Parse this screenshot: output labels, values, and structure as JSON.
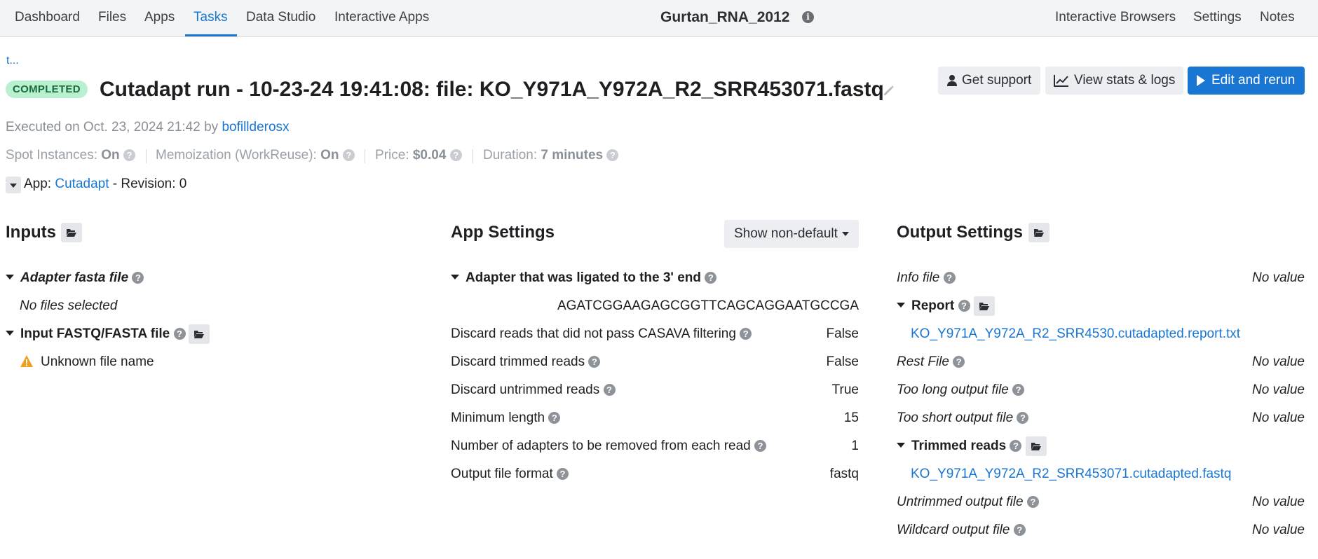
{
  "nav": {
    "left": [
      "Dashboard",
      "Files",
      "Apps",
      "Tasks",
      "Data Studio",
      "Interactive Apps"
    ],
    "active": "Tasks",
    "project": "Gurtan_RNA_2012",
    "right": [
      "Interactive Browsers",
      "Settings",
      "Notes"
    ]
  },
  "header": {
    "back": "t...",
    "status": "COMPLETED",
    "title": "Cutadapt run - 10-23-24 19:41:08: file: KO_Y971A_Y972A_R2_SRR453071.fastq",
    "buttons": {
      "support": "Get support",
      "stats": "View stats & logs",
      "rerun": "Edit and rerun"
    },
    "executed_prefix": "Executed on Oct. 23, 2024 21:42 by",
    "executed_user": "bofillderosx",
    "meta": {
      "spot_label": "Spot Instances:",
      "spot_value": "On",
      "memo_label": "Memoization (WorkReuse):",
      "memo_value": "On",
      "price_label": "Price:",
      "price_value": "$0.04",
      "duration_label": "Duration:",
      "duration_value": "7 minutes"
    },
    "app_label": "App:",
    "app_name": "Cutadapt",
    "revision": "- Revision: 0"
  },
  "inputs": {
    "title": "Inputs",
    "adapter_label": "Adapter fasta file",
    "adapter_value": "No files selected",
    "fastq_label": "Input FASTQ/FASTA file",
    "fastq_value": "Unknown file name"
  },
  "app_settings": {
    "title": "App Settings",
    "filter": "Show non-default",
    "adapter_label": "Adapter that was ligated to the 3' end",
    "adapter_value": "AGATCGGAAGAGCGGTTCAGCAGGAATGCCGA",
    "rows": [
      {
        "label": "Discard reads that did not pass CASAVA filtering",
        "value": "False"
      },
      {
        "label": "Discard trimmed reads",
        "value": "False"
      },
      {
        "label": "Discard untrimmed reads",
        "value": "True"
      },
      {
        "label": "Minimum length",
        "value": "15"
      },
      {
        "label": "Number of adapters to be removed from each read",
        "value": "1"
      },
      {
        "label": "Output file format",
        "value": "fastq"
      }
    ]
  },
  "output_settings": {
    "title": "Output Settings",
    "no_value": "No value",
    "info_label": "Info file",
    "report_label": "Report",
    "report_file": "KO_Y971A_Y972A_R2_SRR4530.cutadapted.report.txt",
    "rest_label": "Rest File",
    "too_long_label": "Too long output file",
    "too_short_label": "Too short output file",
    "trimmed_label": "Trimmed reads",
    "trimmed_file": "KO_Y971A_Y972A_R2_SRR453071.cutadapted.fastq",
    "untrimmed_label": "Untrimmed output file",
    "wildcard_label": "Wildcard output file"
  },
  "colors": {
    "accent": "#1976d2",
    "completed_bg": "#b9f0d0",
    "completed_fg": "#1b6b3c"
  },
  "icons": [
    "info-icon",
    "pencil-icon",
    "user-icon",
    "chart-icon",
    "play-icon",
    "help-icon",
    "folder-open-icon",
    "caret-down-icon",
    "warning-icon"
  ]
}
